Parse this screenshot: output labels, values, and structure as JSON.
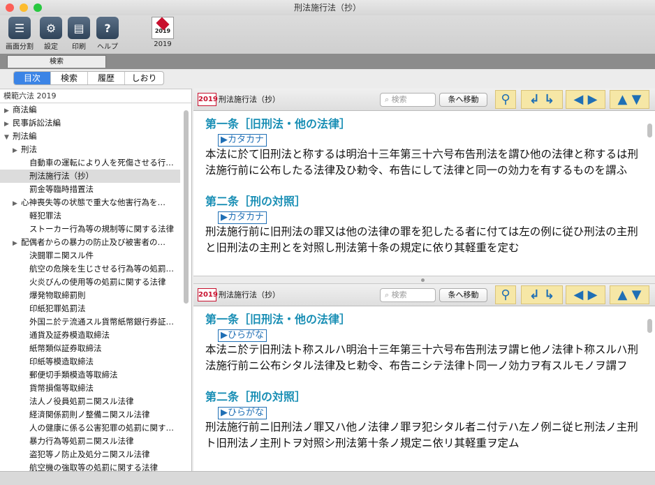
{
  "window": {
    "title": "刑法施行法（抄）"
  },
  "toolbar": {
    "split_label": "画面分割",
    "settings_label": "設定",
    "print_label": "印刷",
    "help_label": "ヘルプ",
    "year_label": "2019"
  },
  "search_tab": "検索",
  "tabs": [
    "目次",
    "検索",
    "履歴",
    "しおり"
  ],
  "sidebar": {
    "header": "模範六法 2019",
    "items": [
      {
        "label": "商法編",
        "indent": 0,
        "arrow": "right"
      },
      {
        "label": "民事訴訟法編",
        "indent": 0,
        "arrow": "right"
      },
      {
        "label": "刑法編",
        "indent": 0,
        "arrow": "down"
      },
      {
        "label": "刑法",
        "indent": 1,
        "arrow": "right"
      },
      {
        "label": "自動車の運転により人を死傷させる行…",
        "indent": 2,
        "arrow": ""
      },
      {
        "label": "刑法施行法（抄）",
        "indent": 2,
        "arrow": "",
        "selected": true
      },
      {
        "label": "罰金等臨時措置法",
        "indent": 2,
        "arrow": ""
      },
      {
        "label": "心神喪失等の状態で重大な他害行為を…",
        "indent": 1,
        "arrow": "right"
      },
      {
        "label": "軽犯罪法",
        "indent": 2,
        "arrow": ""
      },
      {
        "label": "ストーカー行為等の規制等に関する法律",
        "indent": 2,
        "arrow": ""
      },
      {
        "label": "配偶者からの暴力の防止及び被害者の…",
        "indent": 1,
        "arrow": "right"
      },
      {
        "label": "決闘罪ニ関スル件",
        "indent": 2,
        "arrow": ""
      },
      {
        "label": "航空の危険を生じさせる行為等の処罰…",
        "indent": 2,
        "arrow": ""
      },
      {
        "label": "火炎びんの使用等の処罰に関する法律",
        "indent": 2,
        "arrow": ""
      },
      {
        "label": "爆発物取締罰則",
        "indent": 2,
        "arrow": ""
      },
      {
        "label": "印紙犯罪処罰法",
        "indent": 2,
        "arrow": ""
      },
      {
        "label": "外国ニ於テ流通スル貨幣紙幣銀行券証…",
        "indent": 2,
        "arrow": ""
      },
      {
        "label": "通貨及証券模造取締法",
        "indent": 2,
        "arrow": ""
      },
      {
        "label": "紙幣類似証券取締法",
        "indent": 2,
        "arrow": ""
      },
      {
        "label": "印紙等模造取締法",
        "indent": 2,
        "arrow": ""
      },
      {
        "label": "郵便切手類模造等取締法",
        "indent": 2,
        "arrow": ""
      },
      {
        "label": "貨幣損傷等取締法",
        "indent": 2,
        "arrow": ""
      },
      {
        "label": "法人ノ役員処罰ニ関スル法律",
        "indent": 2,
        "arrow": ""
      },
      {
        "label": "経済関係罰則ノ整備ニ関スル法律",
        "indent": 2,
        "arrow": ""
      },
      {
        "label": "人の健康に係る公害犯罪の処罰に関す…",
        "indent": 2,
        "arrow": ""
      },
      {
        "label": "暴力行為等処罰ニ関スル法律",
        "indent": 2,
        "arrow": ""
      },
      {
        "label": "盗犯等ノ防止及処分ニ関スル法律",
        "indent": 2,
        "arrow": ""
      },
      {
        "label": "航空機の強取等の処罰に関する法律",
        "indent": 2,
        "arrow": ""
      }
    ]
  },
  "panes": [
    {
      "badge": "2019",
      "title": "刑法施行法（抄）",
      "search_placeholder": "検索",
      "jump_label": "条へ移動",
      "articles": [
        {
          "heading": "第一条［旧刑法・他の法律］",
          "mode": "▶カタカナ",
          "text": "本法に於て旧刑法と称するは明治十三年第三十六号布告刑法を謂ひ他の法律と称するは刑法施行前に公布したる法律及ひ勅令、布告にして法律と同一の効力を有するものを謂ふ"
        },
        {
          "heading": "第二条［刑の対照］",
          "mode": "▶カタカナ",
          "text": "刑法施行前に旧刑法の罪又は他の法律の罪を犯したる者に付ては左の例に従ひ刑法の主刑と旧刑法の主刑とを対照し刑法第十条の規定に依り其軽重を定む"
        }
      ]
    },
    {
      "badge": "2019",
      "title": "刑法施行法（抄）",
      "search_placeholder": "検索",
      "jump_label": "条へ移動",
      "articles": [
        {
          "heading": "第一条［旧刑法・他の法律］",
          "mode": "▶ひらがな",
          "text": "本法ニ於テ旧刑法ト称スルハ明治十三年第三十六号布告刑法ヲ謂ヒ他ノ法律ト称スルハ刑法施行前ニ公布シタル法律及ヒ勅令、布告ニシテ法律ト同一ノ効力ヲ有スルモノヲ謂フ"
        },
        {
          "heading": "第二条［刑の対照］",
          "mode": "▶ひらがな",
          "text": "刑法施行前ニ旧刑法ノ罪又ハ他ノ法律ノ罪ヲ犯シタル者ニ付テハ左ノ例ニ従ヒ刑法ノ主刑ト旧刑法ノ主刑トヲ対照シ刑法第十条ノ規定ニ依リ其軽重ヲ定ム"
        }
      ]
    }
  ],
  "colors": {
    "accent": "#3b84e6",
    "heading": "#1a8fb5",
    "badge": "#c8102e",
    "nav_bg": "#f6e7a6"
  }
}
